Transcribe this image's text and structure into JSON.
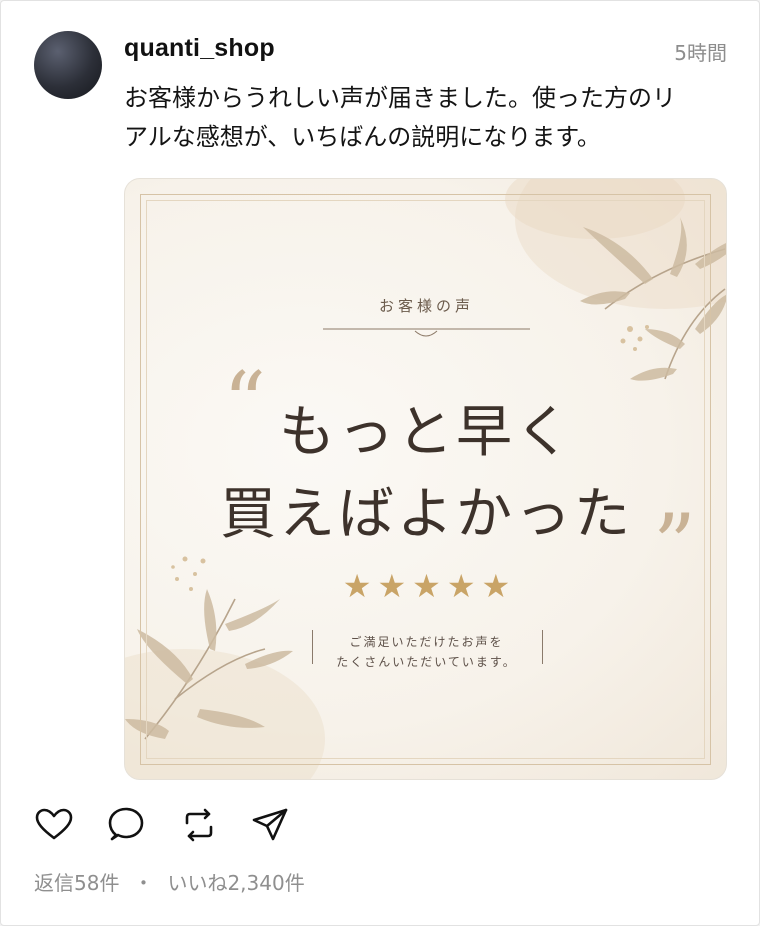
{
  "post": {
    "username": "quanti_shop",
    "time": "5時間",
    "caption_line1": "お客様からうれしい声が届きました。使った方のリ",
    "caption_line2": "アルな感想が、いちばんの説明になります。"
  },
  "image": {
    "section_title": "お客様の声",
    "headline_line1": "もっと早く",
    "headline_line2": "買えばよかった",
    "open_quote": "“",
    "close_quote": "”",
    "rating": "★★★★★",
    "sub_line1": "ご満足いただけたお声を",
    "sub_line2": "たくさんいただいています。",
    "colors": {
      "accent_gold": "#c9a467",
      "text_dark": "#3d322b"
    }
  },
  "actions": {
    "icons": [
      "heart-icon",
      "comment-icon",
      "repost-icon",
      "share-icon"
    ]
  },
  "stats": {
    "replies": "返信58件",
    "separator": "・",
    "likes": "いいね2,340件"
  }
}
